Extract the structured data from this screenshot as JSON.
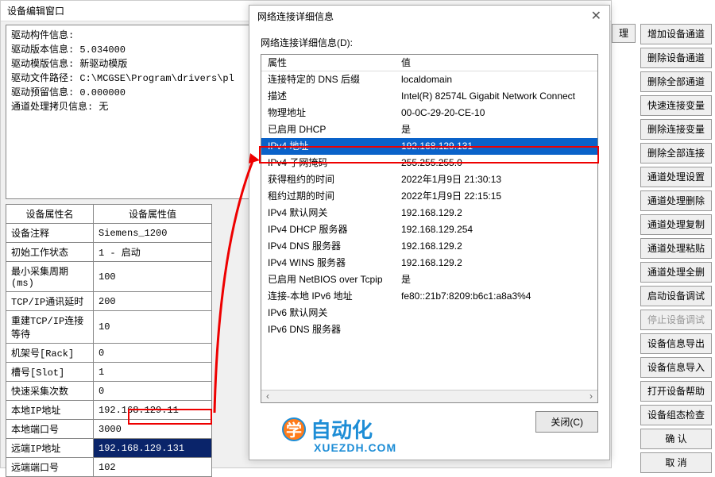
{
  "main": {
    "title": "设备编辑窗口",
    "info_lines": [
      "驱动构件信息:",
      "驱动版本信息: 5.034000",
      "驱动模版信息: 新驱动模版",
      "驱动文件路径: C:\\MCGSE\\Program\\drivers\\pl",
      "驱动预留信息: 0.000000",
      "通道处理拷贝信息: 无"
    ],
    "prop_head_a": "设备属性名",
    "prop_head_b": "设备属性值",
    "props": [
      {
        "k": "设备注释",
        "v": "Siemens_1200"
      },
      {
        "k": "初始工作状态",
        "v": "1 - 启动"
      },
      {
        "k": "最小采集周期(ms)",
        "v": "100"
      },
      {
        "k": "TCP/IP通讯延时",
        "v": "200"
      },
      {
        "k": "重建TCP/IP连接等待",
        "v": "10"
      },
      {
        "k": "机架号[Rack]",
        "v": "0"
      },
      {
        "k": "槽号[Slot]",
        "v": "1"
      },
      {
        "k": "快速采集次数",
        "v": "0"
      },
      {
        "k": "本地IP地址",
        "v": "192.168.129.11"
      },
      {
        "k": "本地端口号",
        "v": "3000"
      },
      {
        "k": "远端IP地址",
        "v": "192.168.129.131",
        "sel": true,
        "red": true
      },
      {
        "k": "远端端口号",
        "v": "102"
      }
    ]
  },
  "dlg": {
    "title": "网络连接详细信息",
    "label": "网络连接详细信息(D):",
    "head_a": "属性",
    "head_b": "值",
    "rows": [
      {
        "a": "连接特定的 DNS 后缀",
        "b": "localdomain"
      },
      {
        "a": "描述",
        "b": "Intel(R) 82574L Gigabit Network Connect"
      },
      {
        "a": "物理地址",
        "b": "00-0C-29-20-CE-10"
      },
      {
        "a": "已启用 DHCP",
        "b": "是"
      },
      {
        "a": "IPv4 地址",
        "b": "192.168.129.131",
        "hl": true,
        "red": true
      },
      {
        "a": "IPv4 子网掩码",
        "b": "255.255.255.0"
      },
      {
        "a": "获得租约的时间",
        "b": "2022年1月9日 21:30:13"
      },
      {
        "a": "租约过期的时间",
        "b": "2022年1月9日 22:15:15"
      },
      {
        "a": "IPv4 默认网关",
        "b": "192.168.129.2"
      },
      {
        "a": "IPv4 DHCP 服务器",
        "b": "192.168.129.254"
      },
      {
        "a": "IPv4 DNS 服务器",
        "b": "192.168.129.2"
      },
      {
        "a": "IPv4 WINS 服务器",
        "b": "192.168.129.2"
      },
      {
        "a": "已启用 NetBIOS over Tcpip",
        "b": "是"
      },
      {
        "a": "连接-本地 IPv6 地址",
        "b": "fe80::21b7:8209:b6c1:a8a3%4"
      },
      {
        "a": "IPv6 默认网关",
        "b": ""
      },
      {
        "a": "IPv6 DNS 服务器",
        "b": ""
      }
    ],
    "close_btn": "关闭(C)"
  },
  "side": [
    {
      "t": "增加设备通道"
    },
    {
      "t": "删除设备通道"
    },
    {
      "t": "删除全部通道"
    },
    {
      "t": "快速连接变量"
    },
    {
      "t": "删除连接变量"
    },
    {
      "t": "删除全部连接"
    },
    {
      "t": "通道处理设置"
    },
    {
      "t": "通道处理删除"
    },
    {
      "t": "通道处理复制"
    },
    {
      "t": "通道处理粘贴"
    },
    {
      "t": "通道处理全删"
    },
    {
      "t": "启动设备调试"
    },
    {
      "t": "停止设备调试",
      "dis": true
    },
    {
      "t": "设备信息导出"
    },
    {
      "t": "设备信息导入"
    },
    {
      "t": "打开设备帮助"
    },
    {
      "t": "设备组态检查"
    },
    {
      "t": "确    认"
    },
    {
      "t": "取    消"
    }
  ],
  "top_btn": "理",
  "wm": {
    "text": "自动化",
    "sub": "XUEZDH.COM",
    "icon": "学"
  }
}
